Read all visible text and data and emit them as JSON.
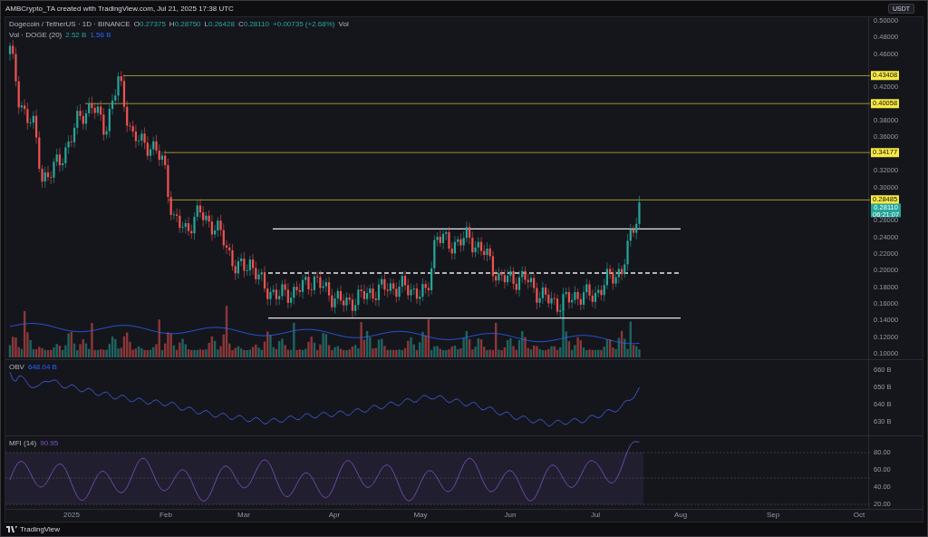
{
  "header": {
    "caption": "AMBCrypto_TA created with TradingView.com, Jul 21, 2025 17:38 UTC"
  },
  "legend": {
    "symbol": "Dogecoin / TetherUS · 1D · BINANCE",
    "ohlc": [
      {
        "key": "O",
        "value": "0.27375"
      },
      {
        "key": "H",
        "value": "0.28750"
      },
      {
        "key": "L",
        "value": "0.26428"
      },
      {
        "key": "C",
        "value": "0.28110"
      }
    ],
    "change": "+0.00735 (+2.68%)",
    "extra": "Vol"
  },
  "volume_legend": {
    "label": "Vol · DOGE (20)",
    "values": [
      "2.52 B",
      "1.56 B"
    ]
  },
  "price_axis": {
    "currency": "USDT",
    "ticks": [
      "0.50000",
      "0.48000",
      "0.46000",
      "0.42000",
      "0.38000",
      "0.36000",
      "0.32000",
      "0.30000",
      "0.26000",
      "0.24000",
      "0.22000",
      "0.20000",
      "0.18000",
      "0.16000",
      "0.14000",
      "0.12000",
      "0.10000"
    ],
    "tags": [
      {
        "kind": "level",
        "value": "0.43408"
      },
      {
        "kind": "level",
        "value": "0.40058"
      },
      {
        "kind": "level",
        "value": "0.34177"
      },
      {
        "kind": "level",
        "value": "0.28485"
      },
      {
        "kind": "last",
        "value": "0.28110",
        "countdown": "06:21:07"
      }
    ]
  },
  "obv": {
    "label": "OBV",
    "value": "648.04 B",
    "ticks": [
      "660 B",
      "650 B",
      "640 B",
      "630 B"
    ]
  },
  "mfi": {
    "label": "MFI (14)",
    "value": "90.95",
    "ticks": [
      "80.00",
      "60.00",
      "40.00",
      "20.00"
    ]
  },
  "time_axis": [
    "2025",
    "Feb",
    "Mar",
    "Apr",
    "May",
    "Jun",
    "Jul",
    "Aug",
    "Sep",
    "Oct"
  ],
  "footer": {
    "brand": "TradingView"
  }
}
